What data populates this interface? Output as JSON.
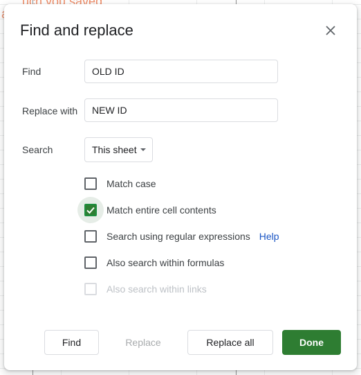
{
  "background": {
    "cell_text_line1": "uch you saved",
    "cell_text_line2": "a"
  },
  "dialog": {
    "title": "Find and replace",
    "close_icon": "close-icon",
    "find": {
      "label": "Find",
      "value": "OLD ID"
    },
    "replace": {
      "label": "Replace with",
      "value": "NEW ID"
    },
    "search": {
      "label": "Search",
      "selected": "This sheet"
    },
    "options": [
      {
        "label": "Match case",
        "checked": false,
        "disabled": false
      },
      {
        "label": "Match entire cell contents",
        "checked": true,
        "disabled": false
      },
      {
        "label": "Search using regular expressions",
        "checked": false,
        "disabled": false,
        "help_label": "Help"
      },
      {
        "label": "Also search within formulas",
        "checked": false,
        "disabled": false
      },
      {
        "label": "Also search within links",
        "checked": false,
        "disabled": true
      }
    ],
    "buttons": {
      "find": "Find",
      "replace": "Replace",
      "replace_all": "Replace all",
      "done": "Done"
    }
  },
  "colors": {
    "primary": "#2e7d32",
    "link": "#1a55c4",
    "sheet_text": "#e8521a"
  }
}
